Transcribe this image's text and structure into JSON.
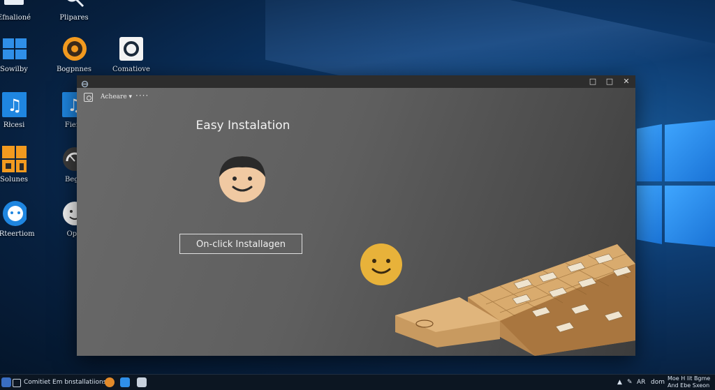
{
  "desktop": {
    "icons": [
      {
        "label": "Efnalioné",
        "icon": "folder-icon"
      },
      {
        "label": "Plipares",
        "icon": "magnifier-icon"
      },
      {
        "label": "Sowilby",
        "icon": "windows-icon"
      },
      {
        "label": "Bogpnnes",
        "icon": "soccer-ball-icon"
      },
      {
        "label": "Comatiove",
        "icon": "ring-icon"
      },
      {
        "label": "Rłcesi",
        "icon": "music-note-icon"
      },
      {
        "label": "Fierc",
        "icon": "music-note-icon"
      },
      {
        "label": "Solunes",
        "icon": "puzzle-icon"
      },
      {
        "label": "Begu",
        "icon": "gauge-icon"
      },
      {
        "label": "URteertiom",
        "icon": "chat-bubble-icon"
      },
      {
        "label": "Opn",
        "icon": "face-icon"
      }
    ]
  },
  "window": {
    "titlebar_icon": "app-icon",
    "controls": {
      "minimize": "□",
      "maximize": "□",
      "close": "✕"
    },
    "toolbar": {
      "label": "Acheare  ▾",
      "more": "····"
    },
    "heading": "Easy Instalation",
    "install_button": "On-click Installagen"
  },
  "taskbar": {
    "search_label": "Comitiet Em bnstallatiions",
    "tray": {
      "lang": "AR",
      "extra": "dom",
      "clock_line1": "Moe H lit Bgme",
      "clock_line2": "And Ebe Sxeon"
    }
  },
  "colors": {
    "accent": "#1a73d6",
    "window_bg": "#5f5f5f",
    "taskbar_bg": "#0c1622"
  }
}
